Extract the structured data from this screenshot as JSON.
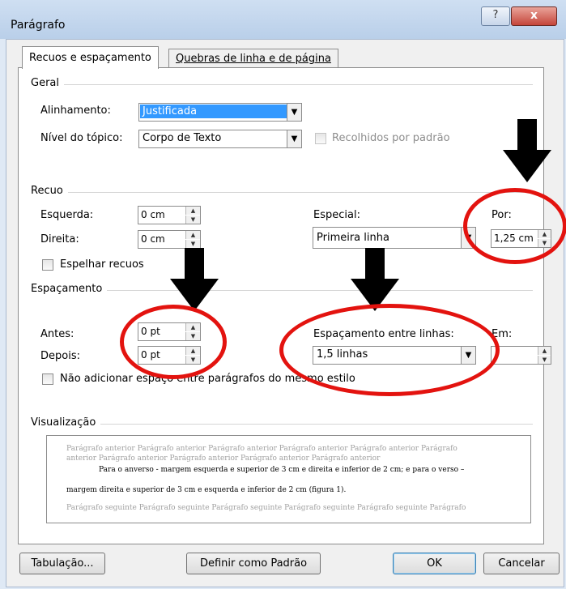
{
  "window": {
    "title": "Parágrafo",
    "help": "?",
    "close": "x"
  },
  "tabs": {
    "indent_spacing": "Recuos e espaçamento",
    "line_page_breaks": "Quebras de linha e de página"
  },
  "general": {
    "group": "Geral",
    "alignment_label": "Alinhamento:",
    "alignment_value": "Justificada",
    "outline_label": "Nível do tópico:",
    "outline_value": "Corpo de Texto",
    "collapsed_label": "Recolhidos por padrão"
  },
  "indent": {
    "group": "Recuo",
    "left_label": "Esquerda:",
    "left_value": "0 cm",
    "right_label": "Direita:",
    "right_value": "0 cm",
    "special_label": "Especial:",
    "special_value": "Primeira linha",
    "by_label": "Por:",
    "by_value": "1,25 cm",
    "mirror_label": "Espelhar recuos"
  },
  "spacing": {
    "group": "Espaçamento",
    "before_label": "Antes:",
    "before_value": "0 pt",
    "after_label": "Depois:",
    "after_value": "0 pt",
    "line_label": "Espaçamento entre linhas:",
    "line_value": "1,5 linhas",
    "at_label": "Em:",
    "at_value": "",
    "no_space_label": "Não adicionar espaço entre parágrafos do mesmo estilo"
  },
  "preview": {
    "group": "Visualização",
    "prev1": "Parágrafo anterior Parágrafo anterior Parágrafo anterior Parágrafo anterior Parágrafo anterior Parágrafo",
    "prev2": "anterior Parágrafo anterior Parágrafo anterior Parágrafo anterior Parágrafo anterior",
    "body1": "Para o anverso - margem esquerda e superior de 3 cm e direita e inferior de 2 cm; e para o verso –",
    "body2": "margem direita e superior de 3 cm e esquerda e inferior de 2 cm (figura 1).",
    "next1": "Parágrafo seguinte Parágrafo seguinte Parágrafo seguinte Parágrafo seguinte Parágrafo seguinte Parágrafo"
  },
  "buttons": {
    "tabs": "Tabulação...",
    "default": "Definir como Padrão",
    "ok": "OK",
    "cancel": "Cancelar"
  },
  "colors": {
    "annotation_red": "#e3130f",
    "selection_blue": "#3399ff"
  }
}
